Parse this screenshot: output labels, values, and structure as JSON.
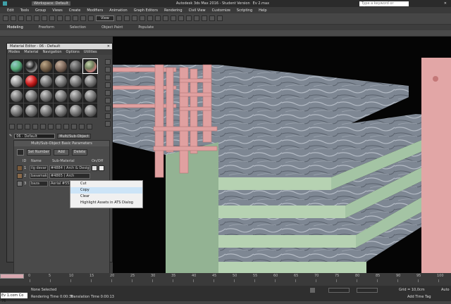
{
  "window": {
    "title": "Autodesk 3ds Max 2016 - Student Version",
    "file": "Ev 2.max",
    "workspace": "Workspace: Default",
    "search_placeholder": "Type a keyword or phrase"
  },
  "menubar": [
    "Edit",
    "Tools",
    "Group",
    "Views",
    "Create",
    "Modifiers",
    "Animation",
    "Graph Editors",
    "Rendering",
    "Civil View",
    "Customize",
    "Scripting",
    "Help"
  ],
  "ribbon_tabs": [
    "Modeling",
    "Freeform",
    "Selection",
    "Object Paint",
    "Populate"
  ],
  "toolbar": {
    "view_dropdown": "View"
  },
  "material_editor": {
    "title": "Material Editor - 06 - Default",
    "menu": [
      "Modes",
      "Material",
      "Navigation",
      "Options",
      "Utilities"
    ],
    "material_name": "06 - Default",
    "material_type": "Multi/Sub-Object",
    "rollout_title": "Multi/Sub-Object Basic Parameters",
    "set_number_label": "Set Number",
    "add_label": "Add",
    "delete_label": "Delete",
    "columns": {
      "id": "ID",
      "name": "Name",
      "sub_material": "Sub-Material",
      "on_off": "On/Off"
    },
    "rows": [
      {
        "id": "1",
        "name": "ilg devar",
        "sub": "#4884 ( Arch & Design )"
      },
      {
        "id": "2",
        "name": "basamak",
        "sub": "#4865 ( Arch"
      },
      {
        "id": "3",
        "name": "baza",
        "sub": "Aerial #5521"
      }
    ]
  },
  "context_menu": {
    "items": [
      "Cut",
      "Copy",
      "Clear",
      "Highlight Assets in ATS Dialog"
    ],
    "highlighted": "Copy"
  },
  "timeline": {
    "ticks": [
      "0",
      "5",
      "10",
      "15",
      "20",
      "25",
      "30",
      "35",
      "40",
      "45",
      "50",
      "55",
      "60",
      "65",
      "70",
      "75",
      "80",
      "85",
      "90",
      "95",
      "100"
    ]
  },
  "status": {
    "script_text": "Ev 1.com  Co 76",
    "selection": "None Selected",
    "rendering_time": "Rendering Time  0:00:36",
    "translation_time": "Translation Time  0:00:13",
    "grid": "Grid = 10,0cm",
    "add_time_tag": "Add Time Tag",
    "auto": "Auto"
  },
  "colors": {
    "marble": "#7f8894",
    "riser_green": "#9fbf9f",
    "railing_pink": "#e2a0a0",
    "selection_highlight": "#cce4f7"
  }
}
